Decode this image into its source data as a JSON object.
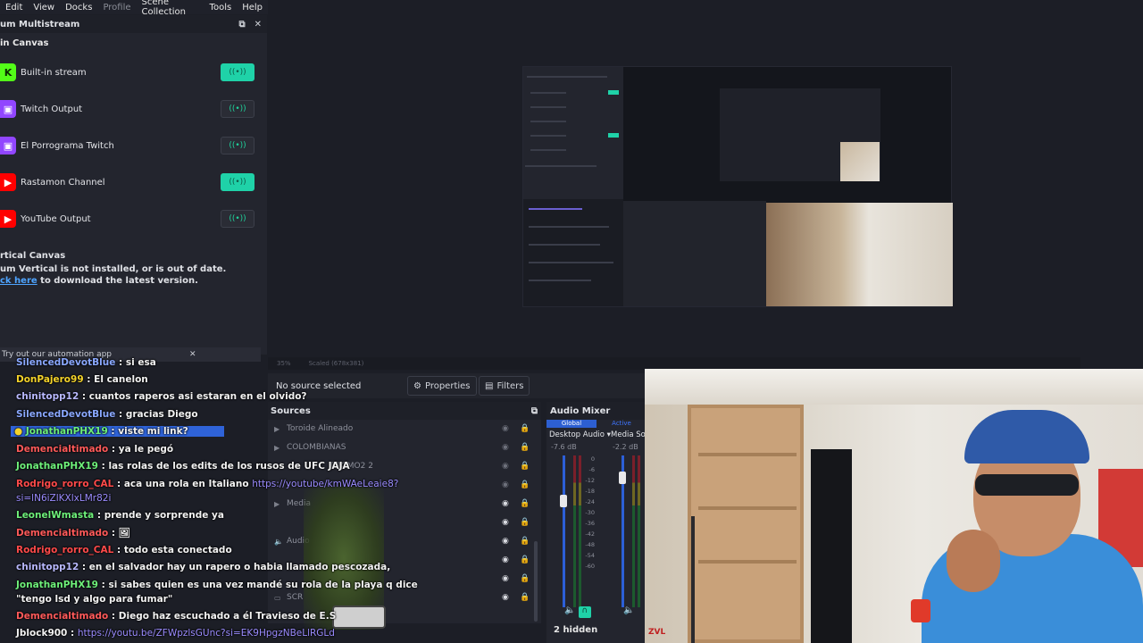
{
  "menu": [
    "Edit",
    "View",
    "Docks",
    "Profile",
    "Scene Collection",
    "Tools",
    "Help"
  ],
  "dock": {
    "title": "um Multistream",
    "main_canvas": "in Canvas",
    "outputs": [
      {
        "label": "Built-in stream",
        "icon": "K",
        "icon_color": "#53fc18",
        "active": true
      },
      {
        "label": "Twitch Output",
        "icon": "▣",
        "icon_color": "#9146ff",
        "active": false
      },
      {
        "label": "El Porrograma Twitch",
        "icon": "▣",
        "icon_color": "#9146ff",
        "active": false
      },
      {
        "label": "Rastamon Channel",
        "icon": "▶",
        "icon_color": "#ff0000",
        "active": true
      },
      {
        "label": "YouTube Output",
        "icon": "▶",
        "icon_color": "#ff0000",
        "active": false
      }
    ],
    "vertical_title": "rtical Canvas",
    "vertical_msg": "um Vertical is not installed, or is out of date.",
    "vertical_link": "ck here",
    "vertical_rest": " to download the latest version."
  },
  "toast": {
    "text": "Try out our automation app"
  },
  "chat": [
    {
      "user": "SilencedDevotBlue",
      "color": "#8aa8ff",
      "text": " : si esa"
    },
    {
      "user": "DonPajero99",
      "color": "#f4d32a",
      "text": " : El canelon"
    },
    {
      "user": "chinitopp12",
      "color": "#b9b9ff",
      "text": " : cuantos raperos asi estaran en el olvido?"
    },
    {
      "user": "SilencedDevotBlue",
      "color": "#8aa8ff",
      "text": " : gracias Diego"
    },
    {
      "user": "JonathanPHX19",
      "color": "#6ef07a",
      "text": " : viste mi link?"
    },
    {
      "user": "Demencialtimado",
      "color": "#ff5a5a",
      "text": " : ya le pegó"
    },
    {
      "user": "JonathanPHX19",
      "color": "#6ef07a",
      "text": " : las rolas de los edits de los rusos de UFC JAJA"
    },
    {
      "user": "Rodrigo_rorro_CAL",
      "color": "#ff4a4a",
      "text": " : aca una rola en Italiano ",
      "link": "https://youtube/kmWAeLeaie8?"
    },
    {
      "user": "",
      "color": "#9b8cff",
      "text": "",
      "link": "si=lN6iZlKXlxLMr82i"
    },
    {
      "user": "LeonelWmasta",
      "color": "#6ef07a",
      "text": " : prende y sorprende ya"
    },
    {
      "user": "Demencialtimado",
      "color": "#ff5a5a",
      "text": " : 🖼"
    },
    {
      "user": "Rodrigo_rorro_CAL",
      "color": "#ff4a4a",
      "text": " : todo esta conectado"
    },
    {
      "user": "chinitopp12",
      "color": "#b9b9ff",
      "text": " : en el salvador hay un rapero o habia llamado pescozada,"
    },
    {
      "user": "JonathanPHX19",
      "color": "#6ef07a",
      "text": " : si sabes quien es una vez mandé su rola de la playa q dice"
    },
    {
      "user": "",
      "color": "#ffffff",
      "text": "\"tengo lsd y algo para fumar\""
    },
    {
      "user": "Demencialtimado",
      "color": "#ff5a5a",
      "text": " : Diego haz escuchado a él Travieso de E.S"
    },
    {
      "user": "Jblock900",
      "color": "#ffffff",
      "text": " : ",
      "link": "https://youtu.be/ZFWpzlsGUnc?si=EK9HpgzNBeLlRGLd"
    }
  ],
  "strip": [
    "35%",
    "Scaled (678x381)"
  ],
  "context": {
    "no_source": "No source selected",
    "properties": "Properties",
    "filters": "Filters"
  },
  "sources": {
    "title": "Sources",
    "items": [
      "Toroide Alineado",
      "COLOMBIANAS",
      "PROMO2 2",
      "",
      "Media",
      "",
      "Audio",
      "",
      "SCR"
    ]
  },
  "mixer": {
    "title": "Audio Mixer",
    "tab_global": "Global",
    "tab_active": "Active",
    "ch1": "Desktop Audio",
    "ch1_db": "-7.6 dB",
    "ch2": "Media Sou",
    "ch2_db": "-2.2 dB",
    "scale": [
      "0",
      "-6",
      "-12",
      "-18",
      "-24",
      "-30",
      "-36",
      "-42",
      "-48",
      "-54",
      "-60"
    ],
    "hidden": "2 hidden"
  },
  "cam": {
    "label": "ZVL"
  }
}
